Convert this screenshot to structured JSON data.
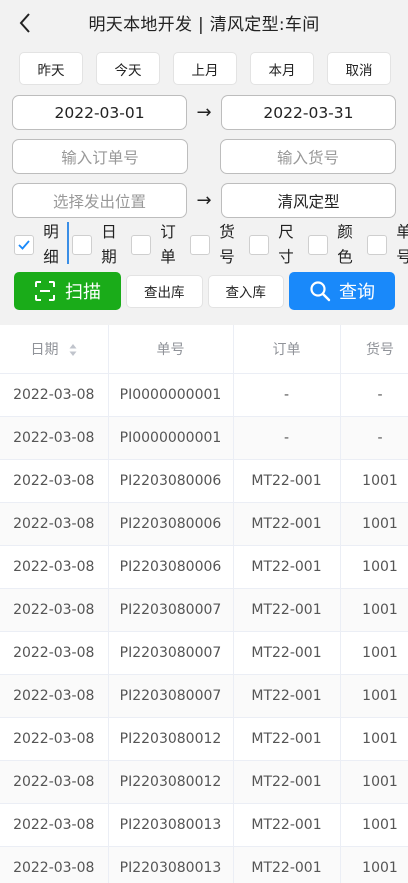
{
  "header": {
    "title": "明天本地开发 | 清风定型:车间",
    "back_icon": "chevron-left-icon"
  },
  "quick_filters": [
    "昨天",
    "今天",
    "上月",
    "本月",
    "取消"
  ],
  "date_range": {
    "start": "2022-03-01",
    "end": "2022-03-31",
    "arrow": "→"
  },
  "order_input": {
    "placeholder": "输入订单号",
    "value": ""
  },
  "goods_input": {
    "placeholder": "输入货号",
    "value": ""
  },
  "location_range": {
    "from_placeholder": "选择发出位置",
    "to": "清风定型",
    "arrow": "→"
  },
  "checkboxes": [
    {
      "label": "明细",
      "checked": true
    },
    {
      "label": "日期",
      "checked": false
    },
    {
      "label": "订单",
      "checked": false
    },
    {
      "label": "货号",
      "checked": false
    },
    {
      "label": "尺寸",
      "checked": false
    },
    {
      "label": "颜色",
      "checked": false
    },
    {
      "label": "单号",
      "checked": false
    }
  ],
  "actions": {
    "scan": "扫描",
    "out_stock": "查出库",
    "in_stock": "查入库",
    "query": "查询"
  },
  "colors": {
    "scan": "#1aac19",
    "query": "#1989fa",
    "check": "#1989fa"
  },
  "table": {
    "columns": [
      "日期",
      "单号",
      "订单",
      "货号"
    ],
    "rows": [
      [
        "2022-03-08",
        "PI0000000001",
        "-",
        "-"
      ],
      [
        "2022-03-08",
        "PI0000000001",
        "-",
        "-"
      ],
      [
        "2022-03-08",
        "PI2203080006",
        "MT22-001",
        "1001"
      ],
      [
        "2022-03-08",
        "PI2203080006",
        "MT22-001",
        "1001"
      ],
      [
        "2022-03-08",
        "PI2203080006",
        "MT22-001",
        "1001"
      ],
      [
        "2022-03-08",
        "PI2203080007",
        "MT22-001",
        "1001"
      ],
      [
        "2022-03-08",
        "PI2203080007",
        "MT22-001",
        "1001"
      ],
      [
        "2022-03-08",
        "PI2203080007",
        "MT22-001",
        "1001"
      ],
      [
        "2022-03-08",
        "PI2203080012",
        "MT22-001",
        "1001"
      ],
      [
        "2022-03-08",
        "PI2203080012",
        "MT22-001",
        "1001"
      ],
      [
        "2022-03-08",
        "PI2203080013",
        "MT22-001",
        "1001"
      ],
      [
        "2022-03-08",
        "PI2203080013",
        "MT22-001",
        "1001"
      ]
    ]
  }
}
